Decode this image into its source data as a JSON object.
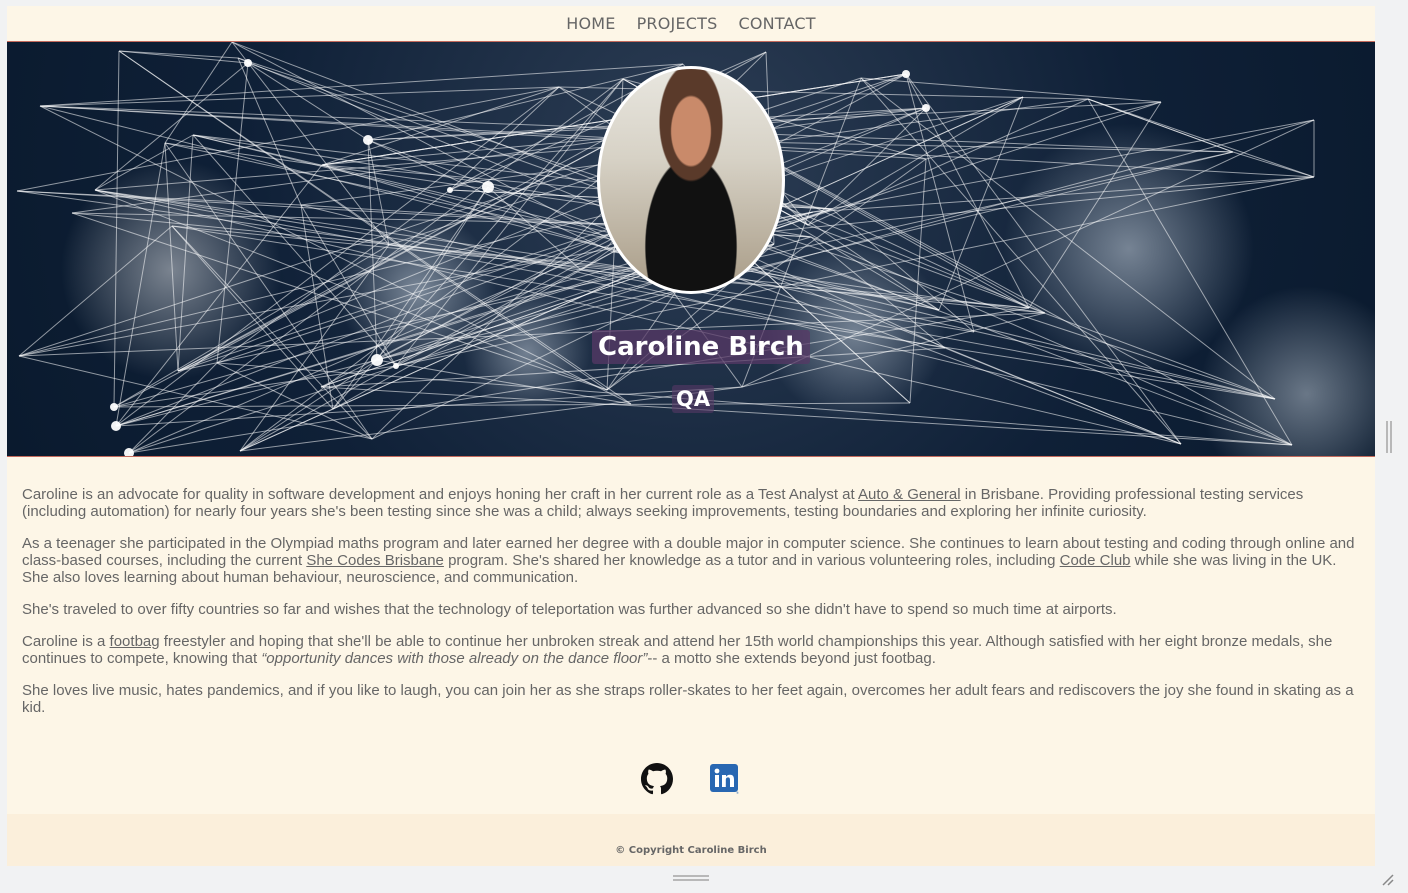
{
  "nav": {
    "home": "HOME",
    "projects": "PROJECTS",
    "contact": "CONTACT"
  },
  "hero": {
    "name": "Caroline Birch",
    "role": "QA"
  },
  "bio": {
    "p1_a": "Caroline is an advocate for quality in software development and enjoys honing her craft in her current role as a Test Analyst at ",
    "p1_link": "Auto & General",
    "p1_b": " in Brisbane. Providing professional testing services (including automation) for nearly four years she's been testing since she was a child; always seeking improvements, testing boundaries and exploring her infinite curiosity.",
    "p2_a": "As a teenager she participated in the Olympiad maths program and later earned her degree with a double major in computer science. She continues to learn about testing and coding through online and class-based courses, including the current ",
    "p2_link1": "She Codes Brisbane",
    "p2_b": " program. She's shared her knowledge as a tutor and in various volunteering roles, including ",
    "p2_link2": "Code Club",
    "p2_c": " while she was living in the UK. She also loves learning about human behaviour, neuroscience, and communication.",
    "p3": "She's traveled to over fifty countries so far and wishes that the technology of teleportation was further advanced so she didn't have to spend so much time at airports.",
    "p4_a": "Caroline is a ",
    "p4_link": "footbag",
    "p4_b": " freestyler and hoping that she'll be able to continue her unbroken streak and attend her 15th world championships this year. Although satisfied with her eight bronze medals, she continues to compete, knowing that ",
    "p4_quote": "“opportunity dances with those already on the dance floor”",
    "p4_c": "-- a motto she extends beyond just footbag.",
    "p5": "She loves live music, hates pandemics, and if you like to laugh, you can join her as she straps roller-skates to her feet again, overcomes her adult fears and rediscovers the joy she found in skating as a kid."
  },
  "social": {
    "github_icon": "github-icon",
    "linkedin_icon": "linkedin-icon",
    "linkedin_color": "#2867b2"
  },
  "footer": {
    "copyright": "© Copyright Caroline Birch"
  },
  "colors": {
    "page_bg": "#fdf6e7",
    "footer_bg": "#fbefdb",
    "accent_line": "#c46a5c",
    "name_badge": "#573866"
  }
}
